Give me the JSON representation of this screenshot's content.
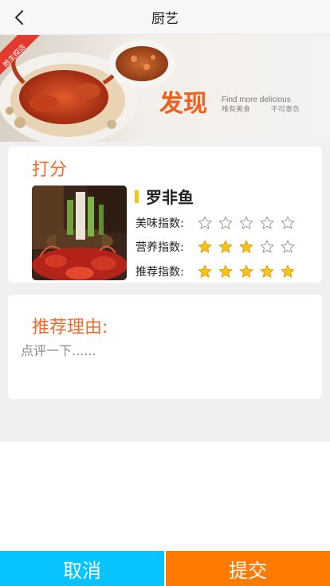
{
  "header": {
    "title": "厨艺",
    "back_icon": "chevron-left-icon"
  },
  "banner": {
    "badge": "她主探店",
    "headline": "发现",
    "subtitle_en": "Find more delicious",
    "subtitle_left": "唯有美食",
    "subtitle_right": "不可辜负"
  },
  "score_card": {
    "title": "打分",
    "dish_name": "罗非鱼",
    "ratings": [
      {
        "label": "美味指数:",
        "value": 0,
        "max": 5
      },
      {
        "label": "营养指数:",
        "value": 3,
        "max": 5
      },
      {
        "label": "推荐指数:",
        "value": 5,
        "max": 5
      }
    ]
  },
  "reason_card": {
    "title": "推荐理由:",
    "placeholder": "点评一下......",
    "value": ""
  },
  "actions": {
    "cancel_label": "取消",
    "submit_label": "提交"
  },
  "colors": {
    "accent": "#f26b2a",
    "star_filled": "#f7c31b",
    "cancel_bg": "#07c3ff",
    "submit_bg": "#ff7a00"
  }
}
